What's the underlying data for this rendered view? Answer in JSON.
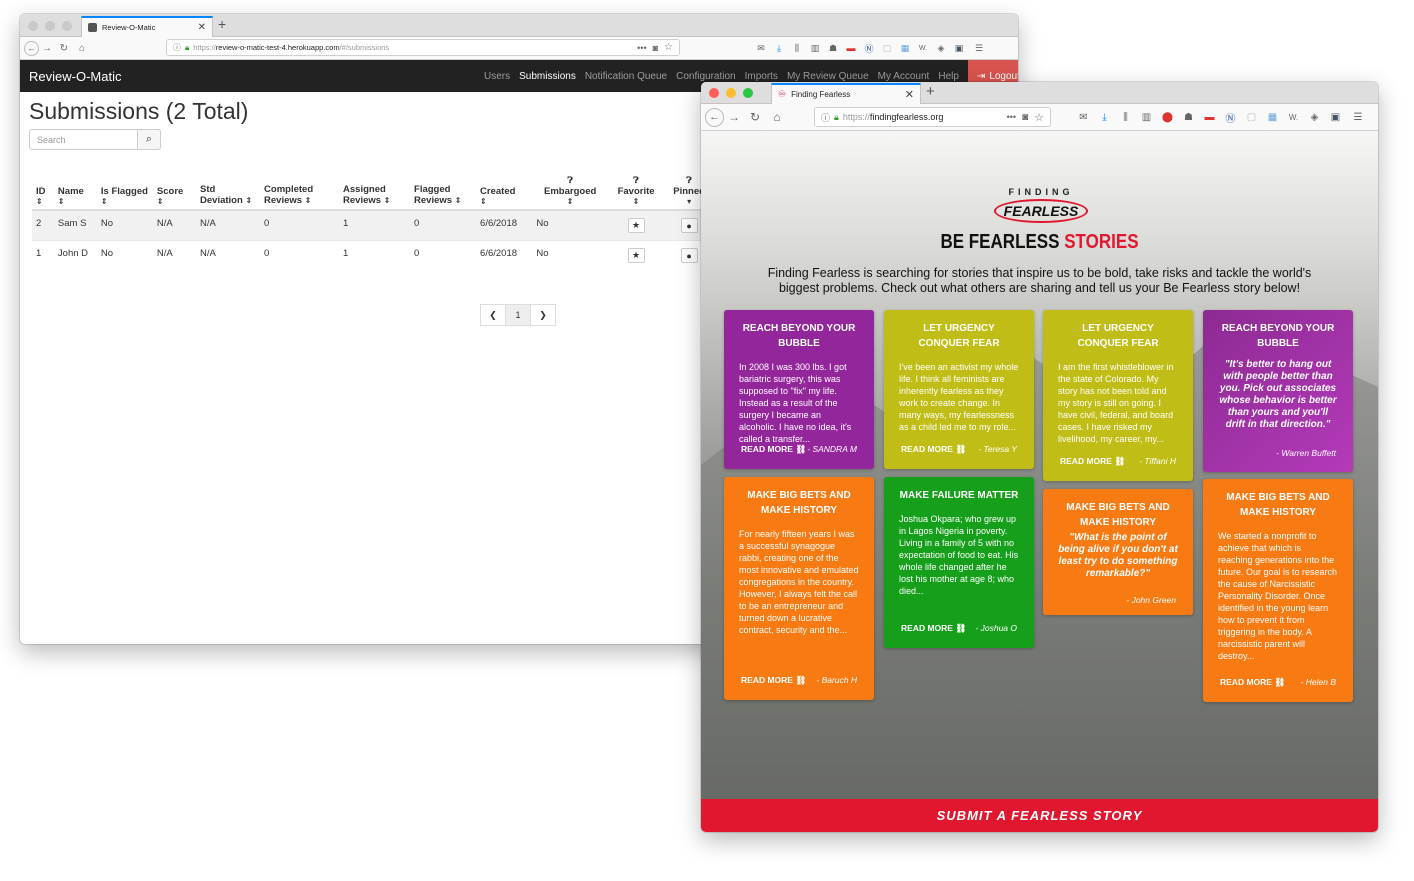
{
  "colors": {
    "accent": "#0a84ff",
    "danger": "#d9534f",
    "ff_red": "#e0172e",
    "purple": "#94269c",
    "olive": "#c0bd16",
    "orange": "#f77a12",
    "green": "#159f1b"
  },
  "win1": {
    "tab_title": "Review-O-Matic",
    "tab_icon": "review-o-matic-favicon",
    "url_prefix": "https://",
    "url_host": "review-o-matic-test-4.herokuapp.com",
    "url_path": "/#/submissions",
    "brand": "Review-O-Matic",
    "nav": [
      "Users",
      "Submissions",
      "Notification Queue",
      "Configuration",
      "Imports",
      "My Review Queue",
      "My Account",
      "Help"
    ],
    "logout": "Logout",
    "heading": "Submissions (2 Total)",
    "search_placeholder": "Search",
    "columns": [
      "ID",
      "Name",
      "Is Flagged",
      "Score",
      "Std Deviation",
      "Completed Reviews",
      "Assigned Reviews",
      "Flagged Reviews",
      "Created",
      "Embargoed",
      "Favorite",
      "Pinned"
    ],
    "rows": [
      [
        "2",
        "Sam S",
        "No",
        "N/A",
        "N/A",
        "0",
        "1",
        "0",
        "6/6/2018",
        "No"
      ],
      [
        "1",
        "John D",
        "No",
        "N/A",
        "N/A",
        "0",
        "1",
        "0",
        "6/6/2018",
        "No"
      ]
    ],
    "pager": {
      "current": "1"
    }
  },
  "win2": {
    "tab_title": "Finding Fearless",
    "url_prefix": "https://",
    "url_host": "findingfearless.org",
    "logo_line1": "FINDING",
    "logo_line2": "FEARLESS",
    "heading_a": "BE FEARLESS",
    "heading_b": "STORIES",
    "intro": "Finding Fearless is searching for stories that inspire us to be bold, take risks and tackle the world's biggest problems. Check out what others are sharing and tell us your Be Fearless story below!",
    "read_more": "READ MORE",
    "submit": "SUBMIT A FEARLESS STORY",
    "cards": [
      {
        "title": "REACH BEYOND YOUR BUBBLE",
        "body": "In 2008 I was 300 lbs. I got bariatric surgery, this was supposed to \"fix\" my life. Instead as a result of the surgery I became an alcoholic. I have no idea, it's called a transfer...",
        "author": "- SANDRA M"
      },
      {
        "title": "LET URGENCY CONQUER FEAR",
        "body": "I've been an activist my whole life. I think all feminists are inherently fearless as they work to create change. In many ways, my fearlessness as a child led me to my role...",
        "author": "- Teresa Y"
      },
      {
        "title": "LET URGENCY CONQUER FEAR",
        "body": "I am the first whistleblower in the state of Colorado. My story has not been told and my story is still on going. I have civil, federal, and board cases. I have risked my livelihood, my career, my...",
        "author": "- Tiffani H"
      },
      {
        "title": "REACH BEYOND YOUR BUBBLE",
        "quote": "\"It's better to hang out with people better than you. Pick out associates whose behavior is better than yours and you'll drift in that direction.\"",
        "author": "- Warren Buffett"
      },
      {
        "title": "MAKE BIG BETS AND MAKE HISTORY",
        "body": "For nearly fifteen years I was a successful synagogue rabbi, creating one of the most innovative and emulated congregations in the country. However, I always felt the call to be an entrepreneur and turned down a lucrative contract, security and the...",
        "author": "- Baruch H"
      },
      {
        "title": "MAKE FAILURE MATTER",
        "body": "Joshua Okpara; who grew up in Lagos Nigeria in poverty. Living in a family of 5 with no expectation of food to eat. His whole life changed after he lost his mother at age 8; who died...",
        "author": "- Joshua O"
      },
      {
        "title": "MAKE BIG BETS AND MAKE HISTORY",
        "quote": "\"What is the point of being alive if you don't at least try to do something remarkable?\"",
        "author": "- John Green"
      },
      {
        "title": "MAKE BIG BETS AND MAKE HISTORY",
        "body": "We started a nonprofit to achieve that which is reaching generations into the future. Our goal is to research the cause of Narcissistic Personality Disorder. Once identified in the young learn how to prevent it from triggering in the body. A narcissistic parent will destroy...",
        "author": "- Helen B"
      }
    ]
  }
}
